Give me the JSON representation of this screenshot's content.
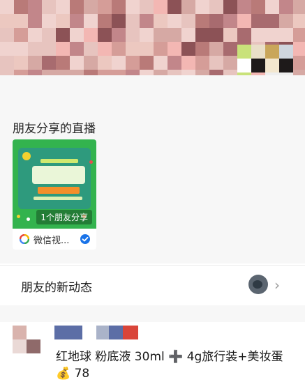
{
  "live_section": {
    "title": "朋友分享的直播",
    "card": {
      "share_tag": "1个朋友分享",
      "channel_name": "微信视..."
    }
  },
  "friends_updates": {
    "label": "朋友的新动态",
    "chevron": "›"
  },
  "post": {
    "text": "红地球 粉底液 30ml ➕ 4g旅行装+美妆蛋 💰 78"
  },
  "colors": {
    "background": "#f7f7f7",
    "thumb_green": "#33b34e",
    "verified_blue": "#1a73e8"
  }
}
